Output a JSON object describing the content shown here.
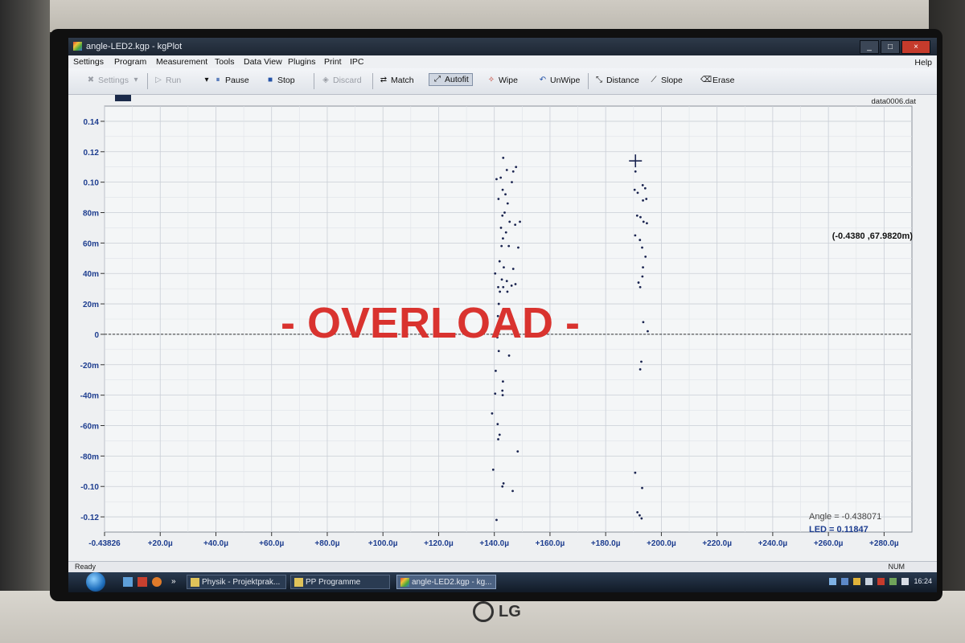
{
  "window": {
    "title": "angle-LED2.kgp - kgPlot",
    "controls": {
      "minimize": "_",
      "maximize": "□",
      "close": "×"
    }
  },
  "menu": {
    "items": [
      "Settings",
      "Program",
      "Measurement",
      "Tools",
      "Data View",
      "Plugins",
      "Print",
      "IPC"
    ],
    "help": "Help"
  },
  "toolbar": {
    "settings": "Settings",
    "run": "Run",
    "pause": "Pause",
    "stop": "Stop",
    "discard": "Discard",
    "match": "Match",
    "autofit": "Autofit",
    "wipe": "Wipe",
    "unwipe": "UnWipe",
    "distance": "Distance",
    "slope": "Slope",
    "erase": "Erase"
  },
  "plot": {
    "filename": "data0006.dat",
    "overload": "- OVERLOAD -",
    "cursor_readout": "(-0.4380 ,67.9820m)",
    "angle_readout": "Angle = -0.438071",
    "led_readout": "LED = 0.11847"
  },
  "chart_data": {
    "type": "scatter",
    "title": "",
    "xlabel": "",
    "ylabel": "",
    "xlim": [
      0,
      290
    ],
    "x_unit": "µ",
    "ylim": [
      -0.13,
      0.15
    ],
    "grid": true,
    "reference_line_y": 0,
    "y_ticks": [
      "0.14",
      "0.12",
      "0.10",
      "80m",
      "60m",
      "40m",
      "20m",
      "0",
      "-20m",
      "-40m",
      "-60m",
      "-80m",
      "-0.10",
      "-0.12"
    ],
    "y_tick_values": [
      0.14,
      0.12,
      0.1,
      0.08,
      0.06,
      0.04,
      0.02,
      0,
      -0.02,
      -0.04,
      -0.06,
      -0.08,
      -0.1,
      -0.12
    ],
    "x_ticks": [
      "-0.43826",
      "+20.0µ",
      "+40.0µ",
      "+60.0µ",
      "+80.0µ",
      "+100.0µ",
      "+120.0µ",
      "+140.0µ",
      "+160.0µ",
      "+180.0µ",
      "+200.0µ",
      "+220.0µ",
      "+240.0µ",
      "+260.0µ",
      "+280.0µ"
    ],
    "x_tick_values": [
      0,
      20,
      40,
      60,
      80,
      100,
      120,
      140,
      160,
      180,
      200,
      220,
      240,
      260,
      280
    ],
    "series": [
      {
        "color": "#1a2450",
        "points": [
          [
            140.8,
            0.102
          ],
          [
            143.2,
            0.116
          ],
          [
            144.5,
            0.108
          ],
          [
            146.8,
            0.107
          ],
          [
            147.8,
            0.11
          ],
          [
            142.3,
            0.103
          ],
          [
            146.3,
            0.1
          ],
          [
            143.0,
            0.095
          ],
          [
            144.0,
            0.092
          ],
          [
            141.5,
            0.089
          ],
          [
            144.8,
            0.086
          ],
          [
            143.7,
            0.08
          ],
          [
            142.9,
            0.078
          ],
          [
            145.5,
            0.074
          ],
          [
            149.2,
            0.074
          ],
          [
            142.4,
            0.07
          ],
          [
            144.2,
            0.067
          ],
          [
            147.5,
            0.072
          ],
          [
            143.1,
            0.063
          ],
          [
            142.6,
            0.058
          ],
          [
            145.2,
            0.058
          ],
          [
            148.6,
            0.057
          ],
          [
            141.9,
            0.048
          ],
          [
            143.4,
            0.044
          ],
          [
            146.8,
            0.043
          ],
          [
            140.3,
            0.04
          ],
          [
            142.7,
            0.036
          ],
          [
            144.5,
            0.035
          ],
          [
            141.4,
            0.031
          ],
          [
            143.2,
            0.031
          ],
          [
            146.2,
            0.032
          ],
          [
            147.6,
            0.033
          ],
          [
            142.0,
            0.028
          ],
          [
            144.7,
            0.028
          ],
          [
            141.6,
            0.02
          ],
          [
            141.3,
            0.012
          ],
          [
            141.2,
            0.003
          ],
          [
            141.1,
            -0.002
          ],
          [
            141.6,
            -0.011
          ],
          [
            145.3,
            -0.014
          ],
          [
            140.5,
            -0.024
          ],
          [
            143.1,
            -0.031
          ],
          [
            142.9,
            -0.037
          ],
          [
            140.3,
            -0.039
          ],
          [
            143.0,
            -0.04
          ],
          [
            139.2,
            -0.052
          ],
          [
            141.2,
            -0.059
          ],
          [
            141.9,
            -0.066
          ],
          [
            141.4,
            -0.069
          ],
          [
            148.4,
            -0.077
          ],
          [
            139.6,
            -0.089
          ],
          [
            143.3,
            -0.098
          ],
          [
            142.9,
            -0.1
          ],
          [
            146.6,
            -0.103
          ],
          [
            140.8,
            -0.122
          ]
        ]
      },
      {
        "color": "#1a2450",
        "points": [
          [
            190.7,
            0.107
          ],
          [
            190.4,
            0.095
          ],
          [
            191.5,
            0.093
          ],
          [
            193.3,
            0.098
          ],
          [
            194.2,
            0.096
          ],
          [
            193.4,
            0.088
          ],
          [
            194.6,
            0.089
          ],
          [
            191.3,
            0.078
          ],
          [
            192.5,
            0.077
          ],
          [
            193.6,
            0.074
          ],
          [
            194.8,
            0.073
          ],
          [
            190.6,
            0.065
          ],
          [
            192.3,
            0.062
          ],
          [
            193.1,
            0.057
          ],
          [
            194.3,
            0.051
          ],
          [
            193.4,
            0.044
          ],
          [
            193.2,
            0.038
          ],
          [
            191.8,
            0.034
          ],
          [
            192.4,
            0.031
          ],
          [
            193.5,
            0.008
          ],
          [
            195.1,
            0.002
          ],
          [
            192.8,
            -0.018
          ],
          [
            192.4,
            -0.023
          ],
          [
            190.6,
            -0.091
          ],
          [
            193.1,
            -0.101
          ],
          [
            191.4,
            -0.117
          ],
          [
            192.2,
            -0.119
          ],
          [
            192.9,
            -0.121
          ]
        ]
      }
    ],
    "cursor_marker": [
      190.7,
      0.114
    ]
  },
  "status": {
    "left": "Ready",
    "right": "NUM"
  },
  "taskbar": {
    "tasks": [
      "Physik - Projektprak...",
      "PP Programme",
      "angle-LED2.kgp - kg..."
    ],
    "more": "»",
    "time": "16:24"
  }
}
